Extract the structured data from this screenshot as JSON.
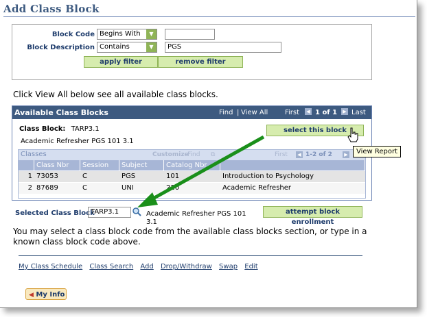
{
  "page": {
    "title": "Add Class Block",
    "instruction_top": "Click View All below see all available class blocks.",
    "instruction_bottom": "You may select a class block code from the available class blocks section, or type in a known class block code above."
  },
  "filters": {
    "block_code_label": "Block Code",
    "block_code_operator": "Begins With",
    "block_code_value": "",
    "block_desc_label": "Block Description",
    "block_desc_operator": "Contains",
    "block_desc_value": "PGS",
    "apply_label": "apply filter",
    "remove_label": "remove filter"
  },
  "available_blocks": {
    "title": "Available Class Blocks",
    "find": "Find",
    "view_all": "View All",
    "first": "First",
    "range": "1 of 1",
    "last": "Last",
    "class_block_label": "Class Block:",
    "class_block_code": "TARP3.1",
    "class_block_desc": "Academic Refresher PGS 101 3.1",
    "select_button": "select this block"
  },
  "classes_grid": {
    "title": "Classes",
    "customize": "Customize",
    "find": "Find",
    "first": "First",
    "range": "1-2 of 2",
    "columns": [
      "Class Nbr",
      "Session",
      "Subject",
      "Catalog Nbr",
      ""
    ],
    "rows": [
      {
        "num": "1",
        "class_nbr": "73053",
        "session": "C",
        "subject": "PGS",
        "catalog": "101",
        "descr": "Introduction to Psychology"
      },
      {
        "num": "2",
        "class_nbr": "87689",
        "session": "C",
        "subject": "UNI",
        "catalog": "220",
        "descr": "Academic Refresher"
      }
    ]
  },
  "selected": {
    "label": "Selected Class Block",
    "value": "TARP3.1",
    "desc": "Academic Refresher PGS 101 3.1",
    "attempt_button": "attempt block enrollment"
  },
  "tooltip": "View Report",
  "footer_links": [
    "My Class Schedule",
    "Class Search",
    "Add",
    "Drop/Withdraw",
    "Swap",
    "Edit"
  ],
  "my_info": "My Info",
  "colors": {
    "header_bg": "#3d5a80",
    "button_bg": "#d6ecae",
    "arrow": "#1a8f1a"
  }
}
